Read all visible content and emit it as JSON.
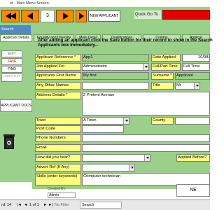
{
  "window": {
    "title": "nt - Main Menu Screen"
  },
  "toolbar": {
    "record_number": "3",
    "new_applicant_label": "NEW APPLICANT",
    "quick_go_label": "Quick Go To :",
    "quick_go_value": ""
  },
  "tabs": {
    "main": "Search Applicants",
    "sub_main": "Applicant Details"
  },
  "subtabs": [
    "Equality and Diversity",
    "More Detail",
    "Qualifications",
    "Comms",
    "Applicat"
  ],
  "sidebar": {
    "edit": "EDIT",
    "save": "SAVE",
    "find": "FIND",
    "undo": "UNDO THIS",
    "docs": "APPLICANT DOCS"
  },
  "annotation": "After adding an applicant click the Save button for their record to show in the Search Applicants box immediately...",
  "form": {
    "applicant_reference_label": "Applicant Reference *",
    "applicant_reference_value": "App1",
    "date_applied_label": "Date Applied",
    "date_applied_value": "10/08/",
    "job_applied_label": "Job Applied For",
    "job_applied_value": "Administrator",
    "full_part_label": "Full/Part Time",
    "full_part_value": "Full Time",
    "first_name_label": "Applicants First Name",
    "first_name_value": "My first",
    "surname_label": "Surname *",
    "surname_value": "Applicant",
    "other_names_label": "Any Other Names",
    "other_names_value": "",
    "title_label": "Title",
    "title_value": "Mr",
    "address_label": "Address Details *",
    "address_value": "2 Pretent Avenue",
    "town_label": "Town",
    "town_value": "A Town",
    "county_label": "County",
    "county_value": "",
    "post_code_label": "Post Code",
    "post_code_value": "",
    "phone_label": "Phone Numbers",
    "phone_value": "",
    "email_label": "Email",
    "email_value": "",
    "how_hear_label": "How did you hear?",
    "how_hear_value": "",
    "applied_before_label": "Applied Before?",
    "advert_ref_label": "Advert Ref (If Any)",
    "advert_ref_value": "",
    "skills_label": "Skills (enter keywords)",
    "skills_value": "Computer technician",
    "created_by_label": "Created By:",
    "created_by_value": "Admin"
  },
  "next_button": "NE",
  "status": {
    "record_label": "rd: 14",
    "record_position": "1 of 1",
    "filter_label": "No Filter",
    "search_placeholder": "Search"
  }
}
